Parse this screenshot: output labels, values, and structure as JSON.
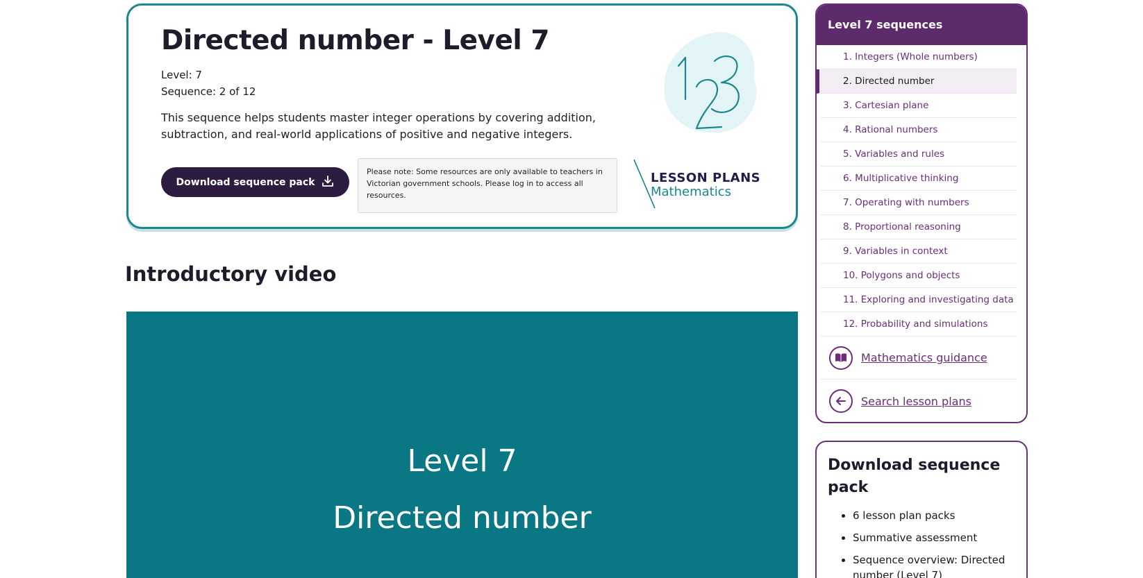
{
  "hero": {
    "title": "Directed number - Level 7",
    "level_label": "Level: 7",
    "sequence_label": "Sequence: 2 of 12",
    "description": "This sequence helps students master integer operations by covering addition, subtraction, and real-world applications of positive and negative integers.",
    "download_button": "Download sequence pack",
    "note": "Please note: Some resources are only available to teachers in Victorian government schools. Please log in to access all resources.",
    "logo_line1": "LESSON PLANS",
    "logo_line2": "Mathematics",
    "art_digits": "123"
  },
  "intro": {
    "heading": "Introductory video",
    "video_line1": "Level 7",
    "video_line2": "Directed number"
  },
  "sidebar": {
    "title": "Level 7 sequences",
    "items": [
      {
        "label": "1. Integers (Whole numbers)"
      },
      {
        "label": "2. Directed number",
        "active": true
      },
      {
        "label": "3. Cartesian plane"
      },
      {
        "label": "4. Rational numbers"
      },
      {
        "label": "5. Variables and rules"
      },
      {
        "label": "6. Multiplicative thinking"
      },
      {
        "label": "7. Operating with numbers"
      },
      {
        "label": "8. Proportional reasoning"
      },
      {
        "label": "9. Variables in context"
      },
      {
        "label": "10. Polygons and objects"
      },
      {
        "label": "11. Exploring and investigating data"
      },
      {
        "label": "12. Probability and simulations"
      }
    ],
    "links": [
      {
        "label": "Mathematics guidance",
        "icon": "book-icon"
      },
      {
        "label": "Search lesson plans",
        "icon": "arrow-left-icon"
      }
    ]
  },
  "pack": {
    "title": "Download sequence pack",
    "items": [
      "6 lesson plan packs",
      "Summative assessment",
      "Sequence overview: Directed number (Level 7)"
    ]
  },
  "colors": {
    "teal": "#1a868d",
    "video_bg": "#0a7884",
    "purple": "#5d2a6b",
    "button": "#2c1c3f"
  }
}
